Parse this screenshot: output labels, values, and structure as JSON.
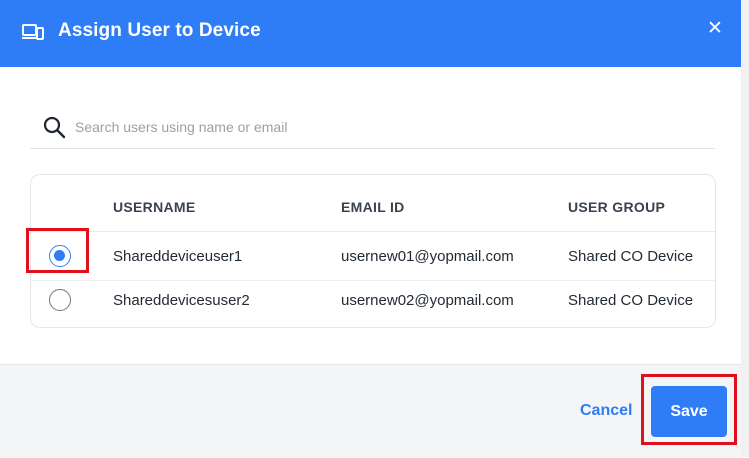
{
  "dialog": {
    "title": "Assign User to Device",
    "header_icon": "device-icon",
    "close_label": "✕",
    "accent_color": "#2e7cf6"
  },
  "search": {
    "placeholder": "Search users using name or email",
    "value": ""
  },
  "table": {
    "columns": [
      "USERNAME",
      "EMAIL ID",
      "USER GROUP"
    ],
    "rows": [
      {
        "selected": true,
        "username": "Shareddeviceuser1",
        "email": "usernew01@yopmail.com",
        "group": "Shared CO Device"
      },
      {
        "selected": false,
        "username": "Shareddevicesuser2",
        "email": "usernew02@yopmail.com",
        "group": "Shared CO Device"
      }
    ]
  },
  "footer": {
    "cancel_label": "Cancel",
    "save_label": "Save"
  },
  "highlight_color": "#e0101a"
}
